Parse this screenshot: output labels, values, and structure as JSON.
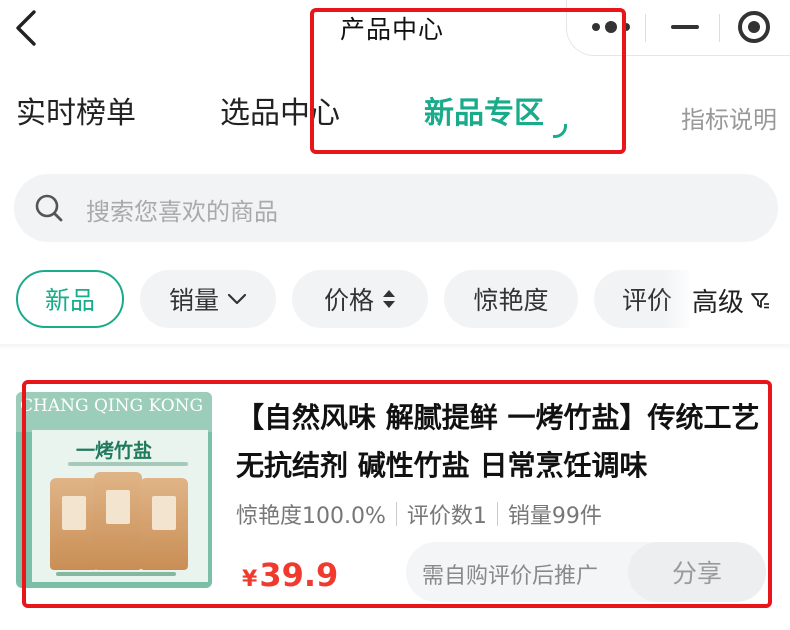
{
  "header": {
    "back_icon": "chevron-left-icon",
    "title": "产品中心",
    "capsule_icons": [
      "more-dots-icon",
      "minimize-icon",
      "close-target-icon"
    ]
  },
  "tabs": [
    {
      "label": "实时榜单",
      "active": false
    },
    {
      "label": "选品中心",
      "active": false
    },
    {
      "label": "新品专区",
      "active": true
    }
  ],
  "tab_help": "指标说明",
  "search": {
    "placeholder": "搜索您喜欢的商品",
    "icon": "search-icon"
  },
  "filters": {
    "chips": [
      {
        "label": "新品",
        "active": true
      },
      {
        "label": "销量",
        "icon": "chevron-down-icon"
      },
      {
        "label": "价格",
        "icon": "sort-updown-icon"
      },
      {
        "label": "惊艳度"
      },
      {
        "label": "评价"
      }
    ],
    "advanced": {
      "label": "高级",
      "icon": "filter-icon"
    }
  },
  "product": {
    "image": {
      "brand": "CHANG QING KONG",
      "name": "一烤竹盐"
    },
    "title": "【自然风味 解腻提鲜 一烤竹盐】传统工艺 无抗结剂 碱性竹盐 日常烹饪调味",
    "stats": [
      "惊艳度100.0%",
      "评价数1",
      "销量99件"
    ],
    "price_currency": "¥",
    "price": "39.9",
    "hint": "需自购评价后推广",
    "share_label": "分享"
  },
  "colors": {
    "accent": "#1aab8a",
    "price": "#f03a2e",
    "annotation": "#e8161a"
  }
}
